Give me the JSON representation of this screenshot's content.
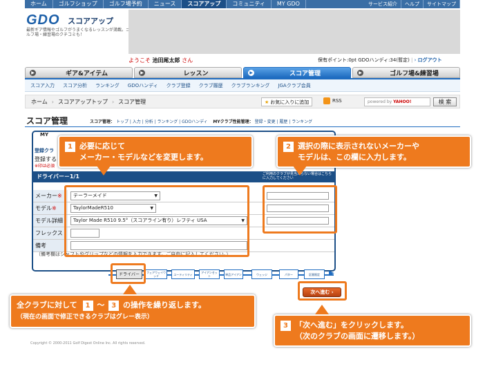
{
  "top_nav": {
    "items": [
      "ホーム",
      "ゴルフショップ",
      "ゴルフ場予約",
      "ニュース",
      "スコアアップ",
      "コミュニティ",
      "MY GDO"
    ],
    "active_index": 4,
    "right_items": [
      "サービス紹介",
      "ヘルプ",
      "サイトマップ"
    ]
  },
  "header": {
    "logo": "GDO",
    "logo_sub": "スコアアップ",
    "tagline": "最新ギア情報やゴルフがうまくなるレッスンが満載。ゴルフ場・練習場のクチコミも！",
    "welcome_prefix": "ようこそ",
    "user_name": "池田尾太郎",
    "welcome_suffix": "さん",
    "points": "保有ポイント:0pt",
    "handicap": "GDOハンディ:34(暫定)",
    "logout": "ログアウト"
  },
  "main_tabs": [
    {
      "label": "ギア&アイテム",
      "active": false
    },
    {
      "label": "レッスン",
      "active": false
    },
    {
      "label": "スコア管理",
      "active": true
    },
    {
      "label": "ゴルフ場&練習場",
      "active": false
    }
  ],
  "sub_nav": [
    "スコア入力",
    "スコア分析",
    "ランキング",
    "GDOハンディ",
    "クラブ登録",
    "クラブ履歴",
    "クラブランキング",
    "JGAクラブ会員"
  ],
  "breadcrumb": [
    "ホーム",
    "スコアアップトップ",
    "スコア管理"
  ],
  "toolbar": {
    "favorite": "お気に入りに追加",
    "rss": "RSS",
    "search_placeholder_prefix": "powered by",
    "search_placeholder_brand": "YAHOO!",
    "search_button": "検 索"
  },
  "page": {
    "title": "スコア管理",
    "score_menu_label": "スコア管理：",
    "score_menu": "トップ | 入力 | 分析 | ランキング | GDOハンディ",
    "club_menu_label": "MYクラブ性能管理：",
    "club_menu": "登録・変更 | 履歴 | ランキング"
  },
  "form": {
    "tab_head": "MY",
    "section": "登録クラ",
    "intro": "登録する",
    "note": "※印は必須",
    "bar_title": "ドライバー－1/1",
    "side_note": "ご利用のクラブが見当たらない場合はこちらに入力してください",
    "rows": [
      {
        "label": "メーカー",
        "required": true,
        "value": "テーラーメイド",
        "select": true
      },
      {
        "label": "モデル",
        "required": true,
        "value": "TaylorMadeR510",
        "select": true
      },
      {
        "label": "モデル詳細",
        "required": false,
        "value": "Taylor Made R510 9.5°（スコアライン有り）レフティ USA",
        "select": true
      },
      {
        "label": "フレックス",
        "required": false,
        "value": "",
        "select": false
      },
      {
        "label": "備考",
        "required": false,
        "value": "",
        "select": false
      }
    ],
    "footnote": "（備考欄はシャフトやグリップなどの情報を入力できます。ご自由に記入してください。）"
  },
  "clubs": [
    "ドライバー",
    "フェアウェイウッド",
    "ユーティリティ",
    "アイアンセット",
    "単品アイアン",
    "ウェッジ",
    "パター",
    "区間限定"
  ],
  "current_club_index": 0,
  "next_button": "次へ進む",
  "copyright": "Copyright © 2000-2011 Golf Digest Online Inc. All rights reserved.",
  "callouts": {
    "c1": {
      "num": "1",
      "line1": "必要に応じて",
      "line2": "メーカー・モデルなどを変更します。"
    },
    "c2": {
      "num": "2",
      "line1": "選択の際に表示されないメーカーや",
      "line2": "モデルは、この欄に入力します。"
    },
    "c3": {
      "num": "3",
      "line1": "「次へ進む」をクリックします。",
      "line2": "（次のクラブの画面に遷移します。）"
    },
    "c4": {
      "prefix": "全クラブに対して",
      "from": "1",
      "tilde": "～",
      "to": "3",
      "suffix": "の操作を繰り返します。",
      "line2": "（現在の画面で修正できるクラブはグレー表示）"
    }
  },
  "colors": {
    "accent": "#ee7a1e",
    "brand_blue": "#1c4f87",
    "required": "#cc0000"
  }
}
